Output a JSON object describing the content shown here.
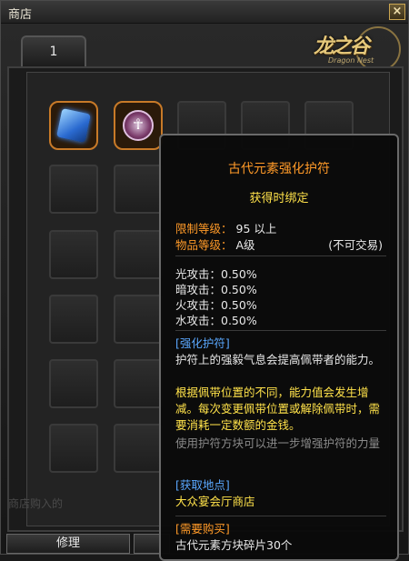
{
  "window": {
    "title": "商店",
    "close_icon": "close-icon"
  },
  "tab": {
    "label": "1"
  },
  "logo": {
    "text": "龙之谷",
    "subtext": "Dragon Nest"
  },
  "grid": {
    "items": [
      {
        "name": "blue-cube-item",
        "icon": "cube-icon"
      },
      {
        "name": "amulet-item",
        "icon": "amulet-icon"
      }
    ]
  },
  "buttons": {
    "repair": "修理"
  },
  "faded_text": "商店购入的",
  "tooltip": {
    "name": "古代元素强化护符",
    "bind": "获得时绑定",
    "level_label": "限制等级：",
    "level_value": "95 以上",
    "grade_label": "物品等级：",
    "grade_value": "A级",
    "trade_note": "(不可交易)",
    "stats": [
      "光攻击：0.50%",
      "暗攻击：0.50%",
      "火攻击：0.50%",
      "水攻击：0.50%"
    ],
    "section1_head": "[强化护符]",
    "section1_body": "护符上的强毅气息会提高佩带者的能力。",
    "section1_warning": "根据佩带位置的不同，能力值会发生增减。每次变更佩带位置或解除佩带时，需要消耗一定数额的金钱。",
    "section1_hint": "使用护符方块可以进一步增强护符的力量",
    "section2_head": "[获取地点]",
    "section2_body": "大众宴会厅商店",
    "section3_head": "[需要购买]",
    "section3_body": "古代元素方块碎片30个"
  },
  "colors": {
    "item_name": "#ff9a28",
    "bind_text": "#ffe24a",
    "section_head": "#5aa8ff",
    "hint_text": "#8a8a8a"
  }
}
